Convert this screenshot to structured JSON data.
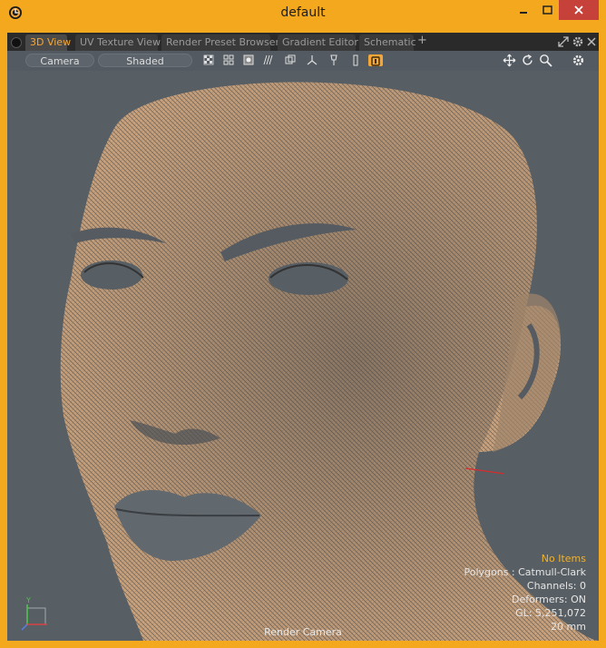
{
  "window": {
    "title": "default"
  },
  "tabs": [
    {
      "label": "3D View",
      "active": true
    },
    {
      "label": "UV Texture View"
    },
    {
      "label": "Render Preset Browser"
    },
    {
      "label": "Gradient Editor"
    },
    {
      "label": "Schematic"
    }
  ],
  "tab_add": "+",
  "toolbar": {
    "camera": "Camera",
    "shading": "Shaded"
  },
  "viewport": {
    "selection": "No Items",
    "polygons": "Polygons : Catmull-Clark",
    "channels": "Channels: 0",
    "deformers": "Deformers: ON",
    "gl": "GL: 5,251,072",
    "lens": "20 mm",
    "camera_label": "Render Camera",
    "axis_y": "Y"
  },
  "colors": {
    "frame": "#f4a81e",
    "accent": "#f3a738",
    "viewport_bg": "#575e64",
    "wire": "#c9a27d",
    "close": "#c7413b"
  }
}
